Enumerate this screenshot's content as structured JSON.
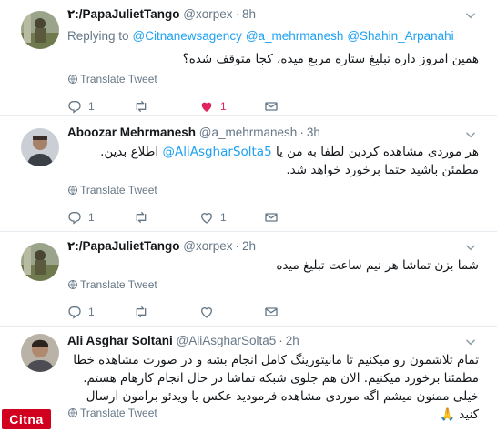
{
  "tweets": [
    {
      "name": "٢:/PapaJulietTango",
      "handle": "@xorpex",
      "time": "8h",
      "replying_prefix": "Replying to",
      "mentions": [
        "@Citnanewsagency",
        "@a_mehrmanesh",
        "@Shahin_Arpanahi"
      ],
      "text": "همین امروز داره تبلیغ ستاره مربع میده، کجا متوقف شده؟",
      "translate": "Translate Tweet",
      "reply_count": "1",
      "retweet_count": "",
      "like_count": "1",
      "liked": true
    },
    {
      "name": "Aboozar Mehrmanesh",
      "handle": "@a_mehrmanesh",
      "time": "3h",
      "text_before_link": "هر موردی مشاهده کردین لطفا به من یا",
      "link": "@AliAsgharSolta5",
      "text_after_link": "اطلاع بدین. مطمئن باشید حتما برخورد خواهد شد.",
      "translate": "Translate Tweet",
      "reply_count": "1",
      "retweet_count": "",
      "like_count": "1"
    },
    {
      "name": "٢:/PapaJulietTango",
      "handle": "@xorpex",
      "time": "2h",
      "text": "شما بزن تماشا هر نیم ساعت تبلیغ میده",
      "translate": "Translate Tweet",
      "reply_count": "1",
      "retweet_count": "",
      "like_count": ""
    },
    {
      "name": "Ali Asghar Soltani",
      "handle": "@AliAsgharSolta5",
      "time": "2h",
      "text": "تمام تلاشمون رو میکنیم تا مانیتورینگ کامل انجام بشه و در صورت مشاهده خطا مطمئنا برخورد میکنیم. الان هم جلوی شبکه تماشا در حال انجام کارهام هستم. خیلی ممنون میشم اگه موردی مشاهده فرمودید عکس یا ویدئو برامون ارسال کنید 🙏",
      "translate": "Translate Tweet"
    }
  ],
  "separator": "·",
  "watermark": "Citna",
  "colors": {
    "link": "#1da1f2",
    "muted": "#657786",
    "like": "#e0245e",
    "border": "#e6ecf0"
  },
  "icons": {
    "reply": "reply-icon",
    "retweet": "retweet-icon",
    "like": "heart-icon",
    "dm": "envelope-icon",
    "translate": "globe-icon",
    "menu": "chevron-down-icon"
  }
}
